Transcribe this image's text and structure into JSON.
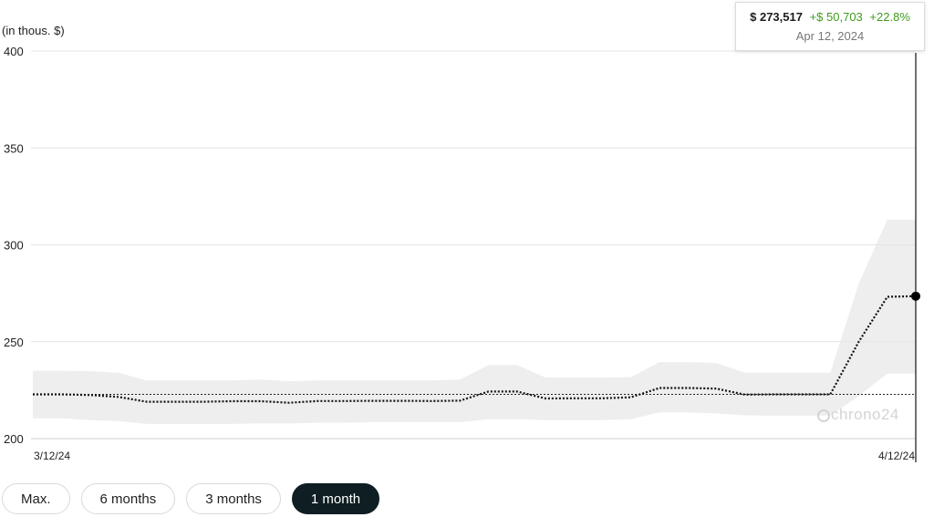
{
  "chart_data": {
    "type": "line",
    "unit_label": "(in thous. $)",
    "ylim": [
      200,
      400
    ],
    "yticks": [
      200,
      250,
      300,
      350,
      400
    ],
    "x_tick_labels": [
      "3/12/24",
      "4/12/24"
    ],
    "x": [
      "2024-03-12",
      "2024-03-13",
      "2024-03-14",
      "2024-03-15",
      "2024-03-16",
      "2024-03-17",
      "2024-03-18",
      "2024-03-19",
      "2024-03-20",
      "2024-03-21",
      "2024-03-22",
      "2024-03-23",
      "2024-03-24",
      "2024-03-25",
      "2024-03-26",
      "2024-03-27",
      "2024-03-28",
      "2024-03-29",
      "2024-03-30",
      "2024-03-31",
      "2024-04-01",
      "2024-04-02",
      "2024-04-03",
      "2024-04-04",
      "2024-04-05",
      "2024-04-06",
      "2024-04-07",
      "2024-04-08",
      "2024-04-09",
      "2024-04-10",
      "2024-04-11",
      "2024-04-12"
    ],
    "series": [
      {
        "values": [
          222.8,
          222.8,
          222.5,
          221.5,
          219,
          219,
          219,
          219.3,
          219.3,
          218.5,
          219.4,
          219.4,
          219.5,
          219.5,
          219.4,
          219.6,
          224.3,
          224.3,
          220.7,
          220.8,
          220.8,
          221.3,
          226.1,
          226.1,
          225.8,
          222.7,
          222.8,
          222.8,
          222.8,
          250,
          273.2,
          273.5
        ]
      },
      {
        "values": [
          235,
          235,
          234.8,
          234,
          230,
          230,
          230,
          230,
          230.5,
          229.6,
          230,
          230,
          230,
          230,
          230,
          230.5,
          238,
          238,
          231.5,
          231.5,
          231.5,
          231.7,
          239.5,
          239.5,
          239,
          234,
          234,
          234,
          234,
          280,
          313,
          313
        ]
      },
      {
        "values": [
          210.5,
          210.5,
          209.5,
          209,
          207.6,
          207.6,
          207.6,
          207.6,
          207.8,
          207.8,
          208.2,
          208.2,
          208.5,
          208.5,
          208.5,
          208.5,
          210,
          210,
          209.5,
          209.5,
          209.5,
          210,
          213.5,
          213.5,
          213,
          212,
          211.8,
          211.8,
          211.8,
          222,
          233.5,
          233.5
        ]
      }
    ],
    "reference_line": 222.8,
    "grid": true,
    "legend": "none"
  },
  "tooltip": {
    "value": "$ 273,517",
    "change_abs": "+$ 50,703",
    "change_pct": "+22.8%",
    "date": "Apr 12, 2024"
  },
  "watermark": "chrono24",
  "colors": {
    "line": "#111111",
    "band": "#eeeeee",
    "gain": "#3f9a1e",
    "active_button": "#0e1e22"
  },
  "range_buttons": [
    {
      "label": "Max.",
      "active": false
    },
    {
      "label": "6 months",
      "active": false
    },
    {
      "label": "3 months",
      "active": false
    },
    {
      "label": "1 month",
      "active": true
    }
  ]
}
